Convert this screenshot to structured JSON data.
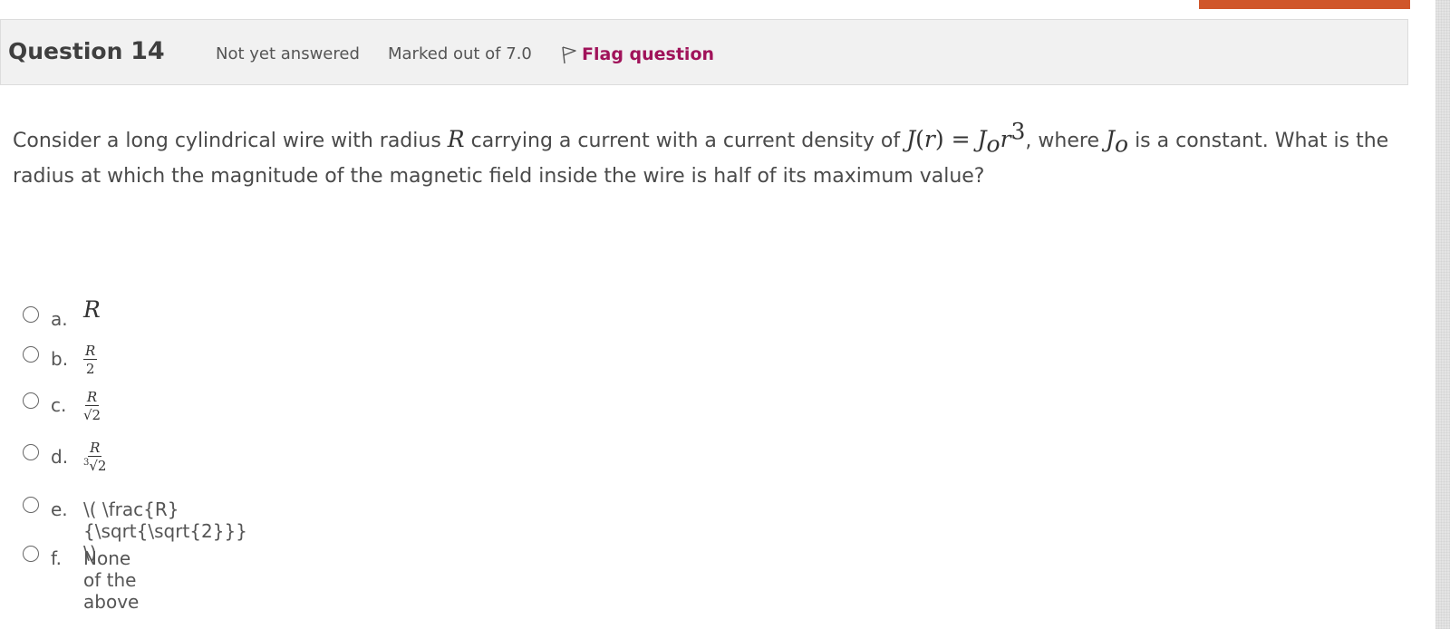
{
  "question": {
    "label": "Question",
    "number": "14",
    "state": "Not yet answered",
    "grade": "Marked out of 7.0",
    "flag_label": "Flag question"
  },
  "text": {
    "p1": "Consider a long cylindrical wire with radius ",
    "R": "R",
    "p2": " carrying a current with a current density of ",
    "J": "J",
    "paren_open": "(",
    "r": "r",
    "paren_close": ")",
    "eq": " = ",
    "J2": "J",
    "sub_o": "o",
    "r2": "r",
    "exp": "3",
    "p3": ", where ",
    "J3": "J",
    "sub_o2": "o",
    "p4": " is a constant. What is the radius at which the magnitude of the magnetic field inside the wire is half of its maximum value?"
  },
  "options": {
    "a": {
      "letter": "a.",
      "math": "R"
    },
    "b": {
      "letter": "b.",
      "num": "R",
      "den": "2"
    },
    "c": {
      "letter": "c.",
      "num": "R",
      "den": "√2"
    },
    "d": {
      "letter": "d.",
      "num": "R",
      "den_index": "3",
      "den": "√2"
    },
    "e": {
      "letter": "e.",
      "text": "\\( \\frac{R}{\\sqrt{\\sqrt{2}}} \\)"
    },
    "f": {
      "letter": "f.",
      "text": "None of the above"
    }
  },
  "colors": {
    "accent": "#d0562b",
    "flag": "#a0135a",
    "info_bg": "#f1f1f1"
  }
}
